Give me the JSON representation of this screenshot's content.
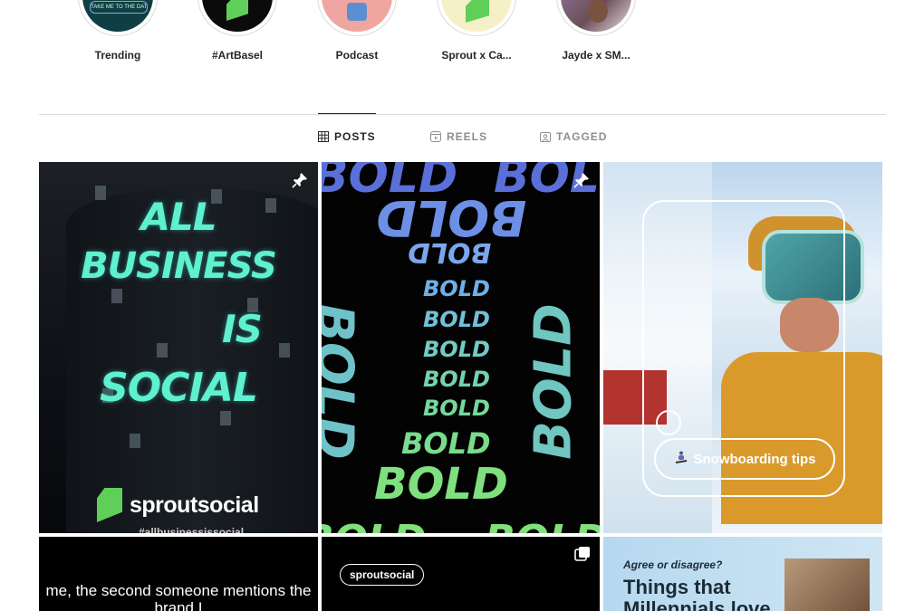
{
  "highlights": [
    {
      "label": "Trending",
      "cover_text": "TAKE ME TO THE DATA"
    },
    {
      "label": "#ArtBasel"
    },
    {
      "label": "Podcast"
    },
    {
      "label": "Sprout x Ca..."
    },
    {
      "label": "Jayde x SM..."
    }
  ],
  "tabs": [
    {
      "label": "POSTS",
      "icon": "grid-icon",
      "active": true
    },
    {
      "label": "REELS",
      "icon": "reels-icon",
      "active": false
    },
    {
      "label": "TAGGED",
      "icon": "tagged-icon",
      "active": false
    }
  ],
  "posts": {
    "p1": {
      "lines": [
        "ALL",
        "BUSINESS",
        "IS",
        "SOCIAL"
      ],
      "brand": "sproutsocial",
      "tag": "#allbusinessissocial",
      "pinned": true
    },
    "p2": {
      "word": "BOLD",
      "pinned": true
    },
    "p3": {
      "pill": "Snowboarding tips",
      "pill_icon": "snowboarder-emoji"
    },
    "p4": {
      "caption": "me, the second someone mentions the brand I"
    },
    "p5": {
      "brand": "sproutsocial",
      "multi": true
    },
    "p6": {
      "question": "Agree or disagree?",
      "headline": "Things that Millennials love"
    }
  },
  "colors": {
    "accent_green": "#5fcf5a",
    "text_primary": "#262626",
    "text_secondary": "#8e8e8e",
    "divider": "#dbdbdb"
  }
}
